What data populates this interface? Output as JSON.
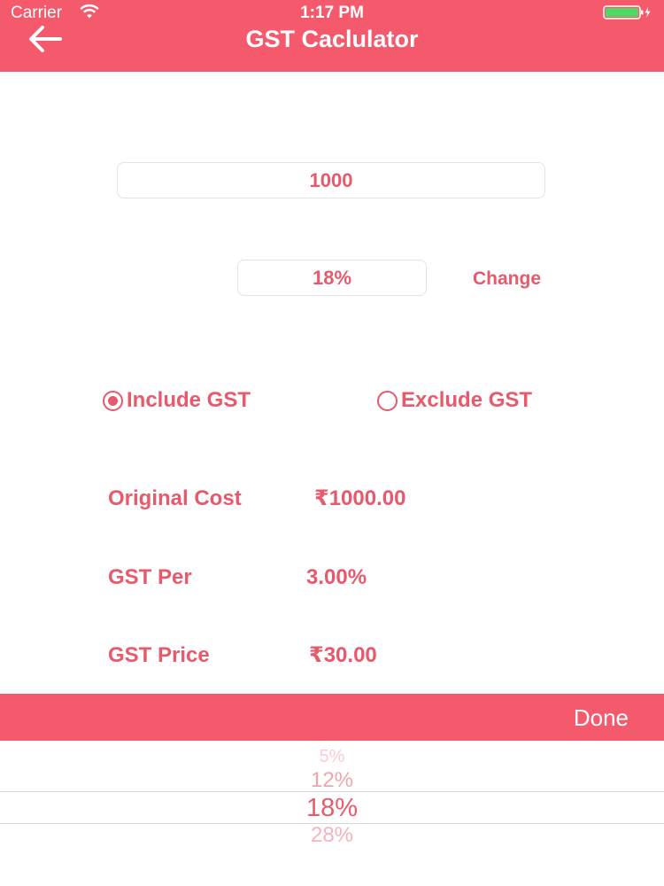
{
  "status_bar": {
    "carrier": "Carrier",
    "time": "1:17 PM"
  },
  "nav": {
    "title": "GST Caclulator",
    "back_icon": "back-arrow-icon"
  },
  "form": {
    "amount_value": "1000",
    "rate_value": "18%",
    "change_label": "Change",
    "include_label": "Include GST",
    "exclude_label": "Exclude GST",
    "selected_mode": "include"
  },
  "results": {
    "original_cost_label": "Original Cost",
    "original_cost_value": "₹1000.00",
    "gst_per_label": "GST Per",
    "gst_per_value": "3.00%",
    "gst_price_label": "GST Price",
    "gst_price_value": "₹30.00"
  },
  "picker": {
    "done_label": "Done",
    "options": [
      "5%",
      "12%",
      "18%",
      "28%"
    ],
    "selected": "18%"
  },
  "colors": {
    "accent": "#f45a6c",
    "text": "#e8596b",
    "battery": "#4cd964"
  }
}
